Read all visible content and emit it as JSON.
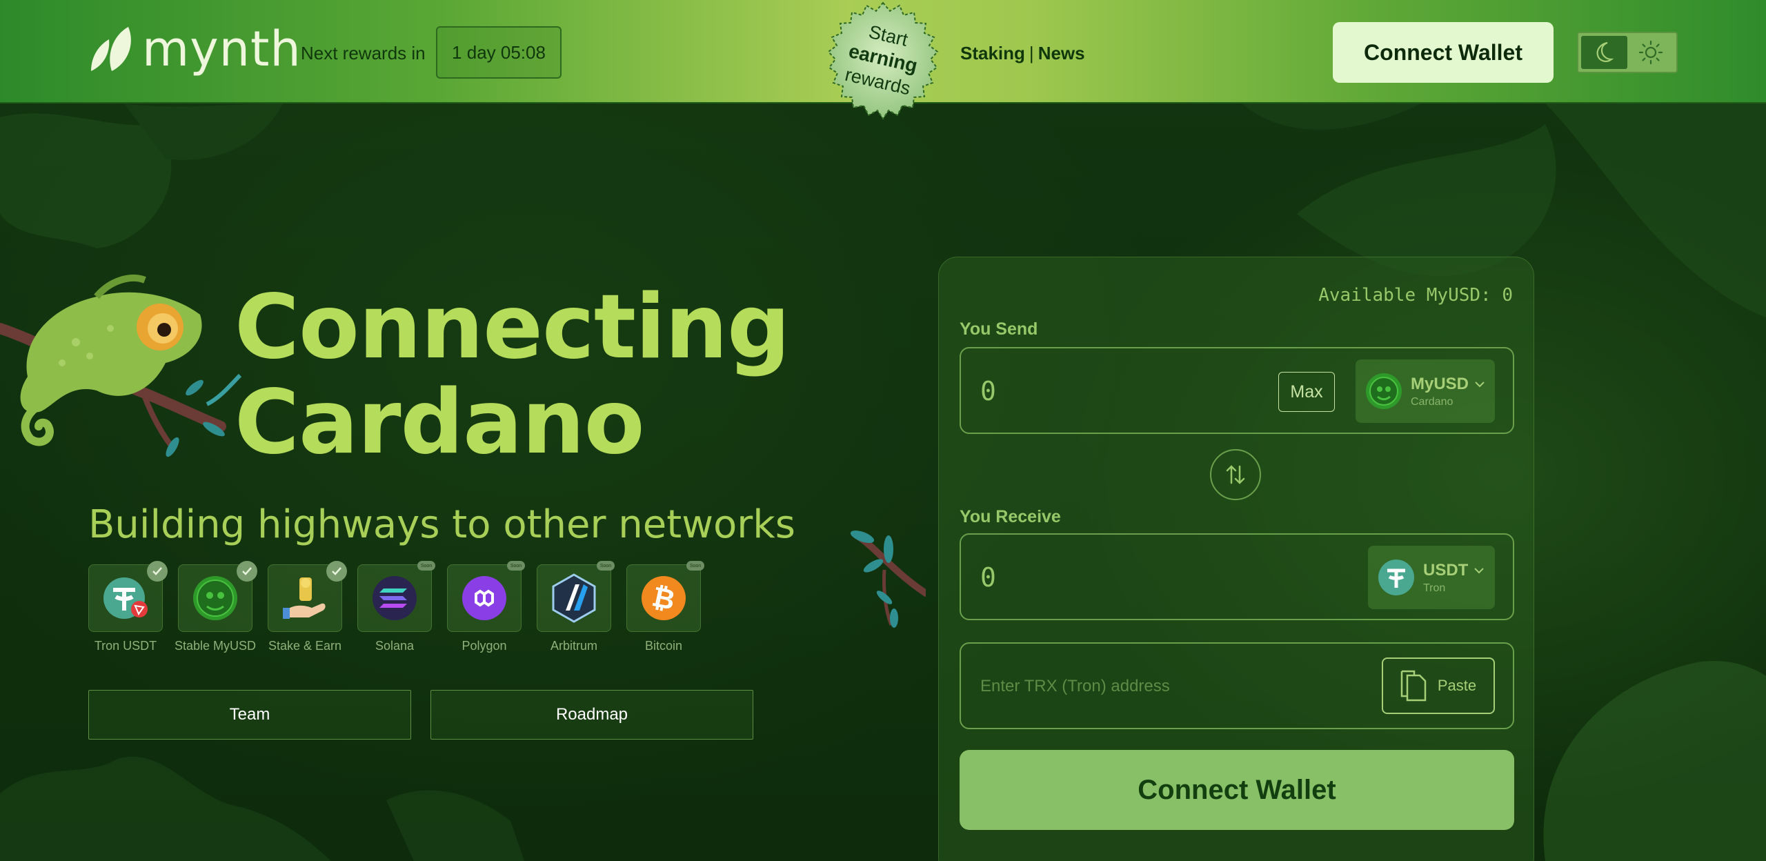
{
  "header": {
    "logo_text": "mynth",
    "rewards_label": "Next rewards in",
    "rewards_timer": "1 day 05:08",
    "badge": {
      "line1": "Start",
      "line2": "earning",
      "line3": "rewards"
    },
    "nav": {
      "staking": "Staking",
      "separator": "|",
      "news": "News"
    },
    "connect_wallet": "Connect Wallet",
    "theme_toggle": {
      "options": [
        "moon-icon",
        "sun-icon"
      ],
      "active": "moon-icon"
    }
  },
  "hero": {
    "title_line1": "Connecting",
    "title_line2": "Cardano",
    "subtitle": "Building highways to other networks",
    "chains": [
      {
        "label": "Tron USDT",
        "icon": "tron-usdt-icon",
        "status": "check"
      },
      {
        "label": "Stable MyUSD",
        "icon": "myusd-icon",
        "status": "check"
      },
      {
        "label": "Stake & Earn",
        "icon": "stake-earn-icon",
        "status": "check"
      },
      {
        "label": "Solana",
        "icon": "solana-icon",
        "status": "soon",
        "soon_text": "Soon"
      },
      {
        "label": "Polygon",
        "icon": "polygon-icon",
        "status": "soon",
        "soon_text": "Soon"
      },
      {
        "label": "Arbitrum",
        "icon": "arbitrum-icon",
        "status": "soon",
        "soon_text": "Soon"
      },
      {
        "label": "Bitcoin",
        "icon": "bitcoin-icon",
        "status": "soon",
        "soon_text": "Soon"
      }
    ],
    "team_button": "Team",
    "roadmap_button": "Roadmap"
  },
  "swap": {
    "available": "Available MyUSD: 0",
    "send_label": "You Send",
    "send_value": "0",
    "max_label": "Max",
    "send_token": {
      "name": "MyUSD",
      "network": "Cardano"
    },
    "receive_label": "You Receive",
    "receive_value": "0",
    "receive_token": {
      "name": "USDT",
      "network": "Tron"
    },
    "address_placeholder": "Enter TRX (Tron) address",
    "paste_label": "Paste",
    "connect_wallet": "Connect Wallet"
  },
  "colors": {
    "accent": "#b5dc5a",
    "header_light": "#a9cd55",
    "header_dark": "#2d8a2a",
    "button_primary": "#88c068",
    "background": "#0d2a0a"
  }
}
